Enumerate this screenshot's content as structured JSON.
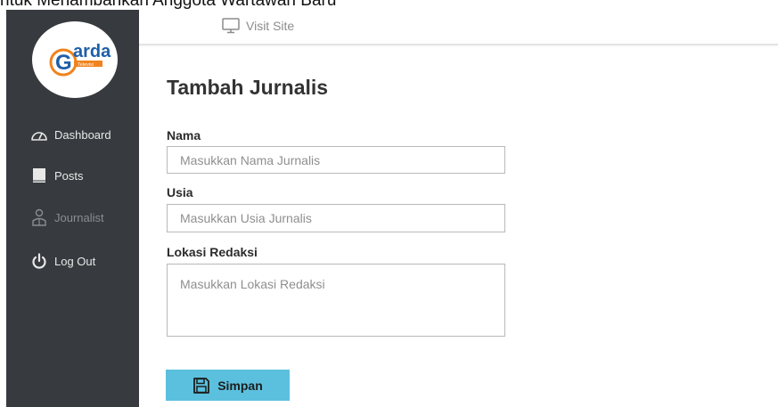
{
  "caption": "ntuk Menambahkan Anggota Wartawan Baru",
  "brand": {
    "logo_text": "arda",
    "logo_initial": "G",
    "logo_subtext": "Televisi"
  },
  "sidebar": {
    "items": [
      {
        "label": "Dashboard",
        "icon": "gauge-icon"
      },
      {
        "label": "Posts",
        "icon": "book-icon"
      },
      {
        "label": "Journalist",
        "icon": "journalist-icon",
        "muted": true
      },
      {
        "label": "Log Out",
        "icon": "power-icon"
      }
    ]
  },
  "topbar": {
    "visit_site_label": "Visit Site",
    "visit_site_icon": "monitor-icon"
  },
  "form": {
    "title": "Tambah Jurnalis",
    "nama": {
      "label": "Nama",
      "placeholder": "Masukkan Nama Jurnalis",
      "value": ""
    },
    "usia": {
      "label": "Usia",
      "placeholder": "Masukkan Usia Jurnalis",
      "value": ""
    },
    "lokasi": {
      "label": "Lokasi Redaksi",
      "placeholder": "Masukkan Lokasi Redaksi",
      "value": ""
    },
    "save_label": "Simpan",
    "save_icon": "floppy-icon"
  },
  "colors": {
    "sidebar_bg": "#373b3f",
    "button_bg": "#5bc0de",
    "logo_blue": "#1f5fa8",
    "logo_orange": "#f0831e"
  }
}
